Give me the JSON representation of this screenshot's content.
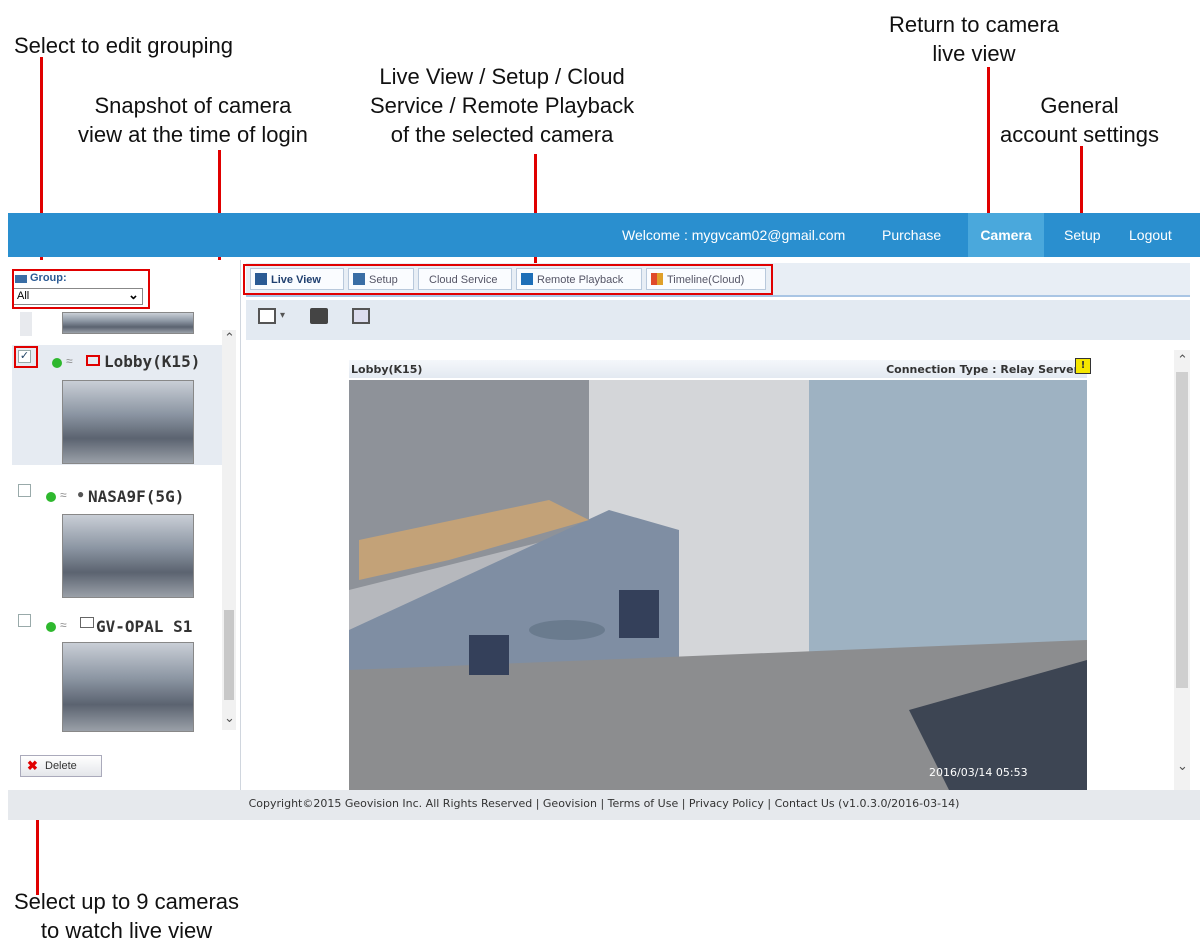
{
  "callouts": {
    "grouping": "Select to edit grouping",
    "snapshot_line1": "Snapshot of camera",
    "snapshot_line2": "view at the time of login",
    "tabs_line1": "Live View / Setup / Cloud",
    "tabs_line2": "Service / Remote Playback",
    "tabs_line3": "of the selected camera",
    "camera_line1": "Return to camera",
    "camera_line2": "live view",
    "account_line1": "General",
    "account_line2": "account settings",
    "select_line1": "Select up to 9 cameras",
    "select_line2": "to watch live view"
  },
  "topnav": {
    "welcome": "Welcome : mygvcam02@gmail.com",
    "purchase": "Purchase",
    "camera": "Camera",
    "setup": "Setup",
    "logout": "Logout"
  },
  "sidebar": {
    "group_label": "Group:",
    "group_value": "All",
    "cameras": [
      {
        "name": "Lobby(K15)",
        "checked": true
      },
      {
        "name": "NASA9F(5G)",
        "checked": false
      },
      {
        "name": "GV-OPAL S1",
        "checked": false
      }
    ],
    "delete_label": "Delete"
  },
  "tabs": [
    {
      "label": "Live View"
    },
    {
      "label": "Setup"
    },
    {
      "label": "Cloud Service"
    },
    {
      "label": "Remote Playback"
    },
    {
      "label": "Timeline(Cloud)"
    }
  ],
  "viewer": {
    "camera_name": "Lobby(K15)",
    "connection": "Connection Type : Relay Server",
    "timestamp": "2016/03/14    05:53"
  },
  "footer": {
    "text": "Copyright©2015 Geovision Inc. All Rights Reserved | Geovision | Terms of Use | Privacy Policy | Contact Us (v1.0.3.0/2016-03-14)"
  },
  "colors": {
    "topbar": "#2a8fcf",
    "callout_red": "#e00000"
  }
}
